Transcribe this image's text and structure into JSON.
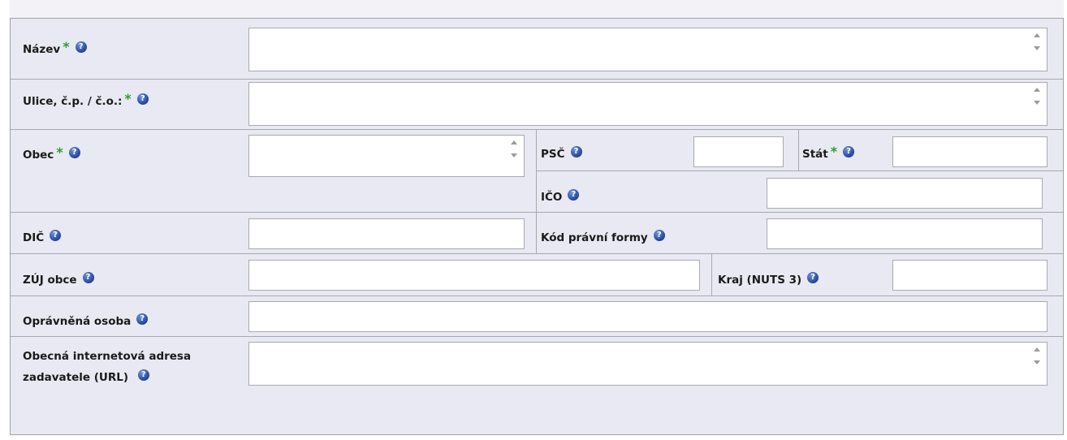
{
  "form": {
    "required_mark": "*",
    "help_glyph": "?",
    "fields": {
      "nazev": {
        "label": "Název",
        "required": true,
        "value": ""
      },
      "ulice": {
        "label": "Ulice, č.p. / č.o.:",
        "required": true,
        "value": ""
      },
      "obec": {
        "label": "Obec",
        "required": true,
        "value": ""
      },
      "psc": {
        "label": "PSČ",
        "required": false,
        "value": ""
      },
      "stat": {
        "label": "Stát",
        "required": true,
        "value": ""
      },
      "ico": {
        "label": "IČO",
        "required": false,
        "value": ""
      },
      "dic": {
        "label": "DIČ",
        "required": false,
        "value": ""
      },
      "kod_pravni_formy": {
        "label": "Kód právní formy",
        "required": false,
        "value": ""
      },
      "zuj_obce": {
        "label": "ZÚJ obce",
        "required": false,
        "value": ""
      },
      "kraj": {
        "label": "Kraj (NUTS 3)",
        "required": false,
        "value": ""
      },
      "opravnena_osoba": {
        "label": "Oprávněná osoba",
        "required": false,
        "value": ""
      },
      "url": {
        "label_line1": "Obecná internetová adresa",
        "label_line2": "zadavatele (URL)",
        "required": false,
        "value": ""
      }
    },
    "colors": {
      "panel_bg": "#e9e9f3",
      "required_mark": "#2e9d2e",
      "help_icon": "#1c3f94",
      "border": "#a8a8b0"
    }
  }
}
